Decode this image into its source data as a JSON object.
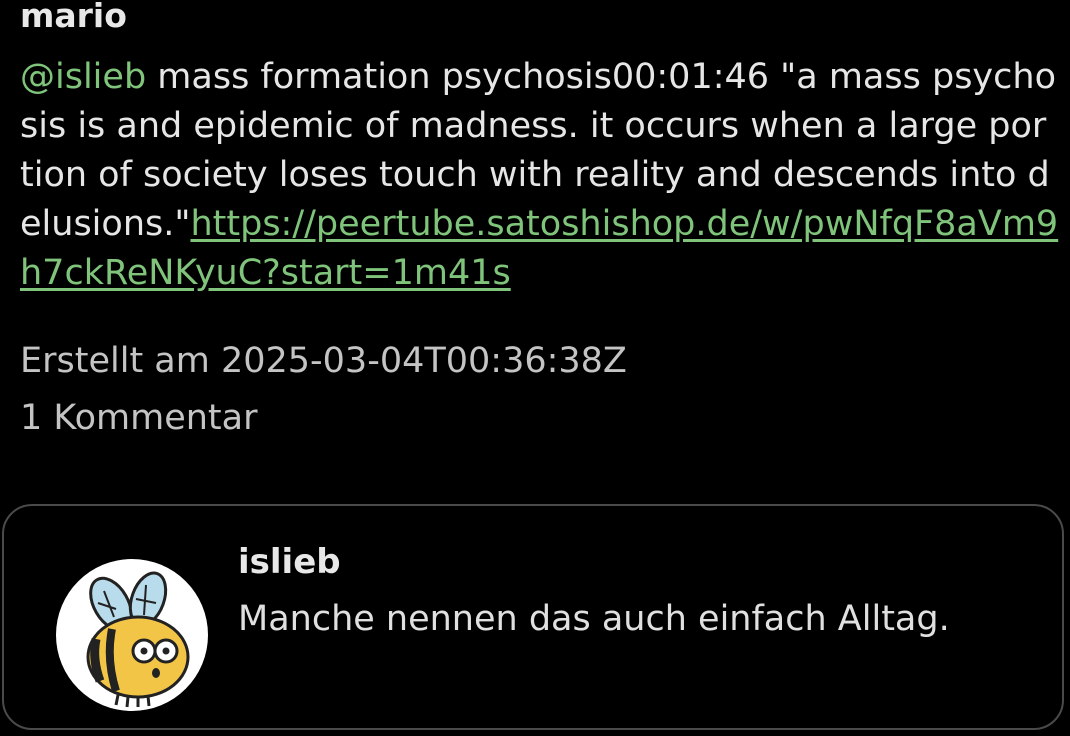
{
  "post": {
    "author": "mario",
    "mention": "@islieb",
    "text": " mass formation psychosis00:01:46 \"a mass psychosis is and epidemic of madness. it occurs when a large portion of society loses touch with reality and descends into delusions.\"",
    "link": "https://peertube.satoshishop.de/w/pwNfqF8aVm9h7ckReNKyuC?start=1m41s",
    "created": "Erstellt am 2025-03-04T00:36:38Z",
    "comment_count": "1 Kommentar"
  },
  "comment": {
    "avatar_icon": "bee-avatar-icon",
    "author": "islieb",
    "text": "Manche nennen das auch einfach Alltag."
  },
  "colors": {
    "background": "#000000",
    "accent": "#7fc47a",
    "text": "#e6e6e6",
    "border": "#4a4a4a"
  }
}
